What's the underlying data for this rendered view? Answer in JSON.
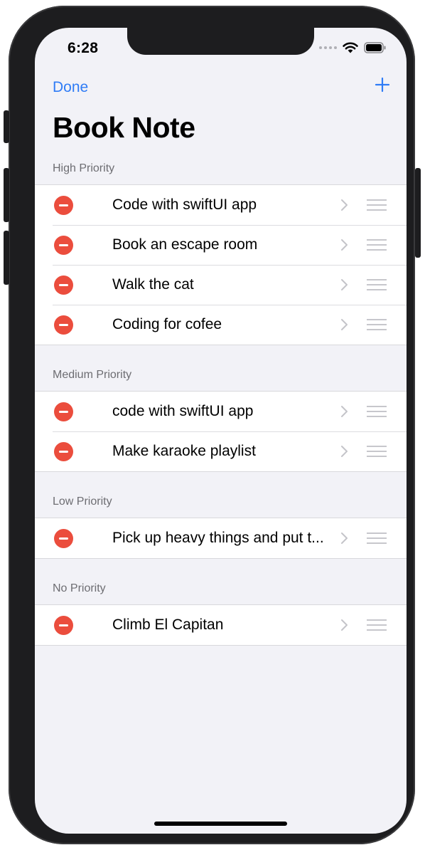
{
  "status_bar": {
    "time": "6:28"
  },
  "nav": {
    "done_label": "Done",
    "add_icon": "plus-icon",
    "title": "Book Note"
  },
  "colors": {
    "accent": "#2f7cf6",
    "delete": "#eb4d3d",
    "background": "#f2f2f7"
  },
  "sections": [
    {
      "header": "High Priority",
      "items": [
        {
          "label": "Code with swiftUI app"
        },
        {
          "label": "Book an escape room"
        },
        {
          "label": "Walk the cat"
        },
        {
          "label": "Coding for cofee"
        }
      ]
    },
    {
      "header": "Medium Priority",
      "items": [
        {
          "label": "code with swiftUI app"
        },
        {
          "label": "Make karaoke playlist"
        }
      ]
    },
    {
      "header": "Low Priority",
      "items": [
        {
          "label": "Pick up heavy things and put t..."
        }
      ]
    },
    {
      "header": "No Priority",
      "items": [
        {
          "label": "Climb El Capitan"
        }
      ]
    }
  ]
}
